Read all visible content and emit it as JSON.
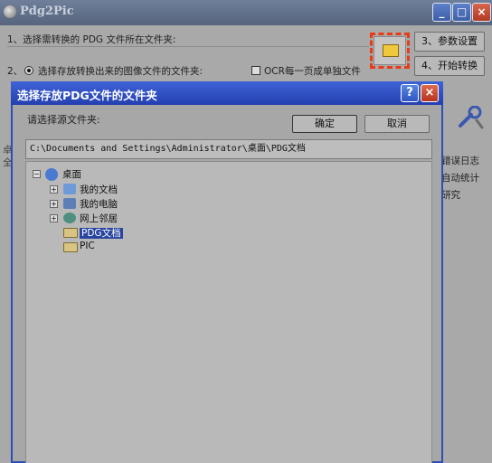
{
  "app": {
    "title": "Pdg2Pic",
    "step1_label": "1、选择需转换的 PDG 文件所在文件夹:",
    "step2_label": "选择存放转换出来的图像文件的文件夹:",
    "step2_prefix": "2、",
    "ocr_label": "OCR每一页成单独文件",
    "settings_button": "3、参数设置",
    "convert_button": "4、开始转换",
    "right_fragments": [
      "错误日志",
      "自动统计",
      "研究"
    ],
    "left_fragments": [
      "卓",
      "全"
    ]
  },
  "dialog": {
    "title": "选择存放PDG文件的文件夹",
    "prompt": "请选择源文件夹:",
    "ok_button": "确定",
    "cancel_button": "取消",
    "path_value": "C:\\Documents and Settings\\Administrator\\桌面\\PDG文档",
    "tree": {
      "root": "桌面",
      "children": [
        "我的文档",
        "我的电脑",
        "网上邻居",
        "PDG文档",
        "PIC"
      ],
      "selected": "PDG文档"
    }
  },
  "colors": {
    "highlight_border": "#ea3a16",
    "dialog_title": "#2a45b8",
    "selected_item": "#2a45a0"
  }
}
